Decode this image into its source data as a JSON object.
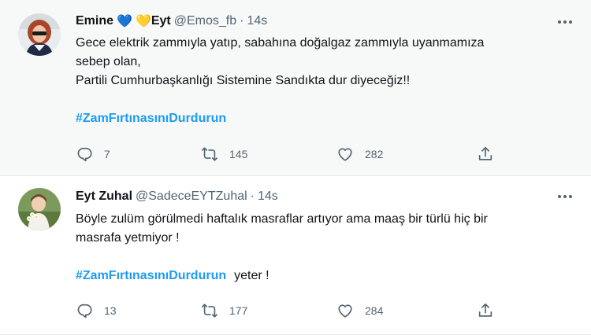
{
  "tweets": [
    {
      "name": "Emine",
      "hearts": [
        "💙",
        "💛"
      ],
      "name_suffix": "Eyt",
      "handle": "@Emos_fb",
      "separator": "·",
      "time": "14s",
      "lines": [
        "Gece elektrik zammıyla yatıp, sabahına doğalgaz zammıyla uyanmamıza",
        "sebep olan,",
        "Partili Cumhurbaşkanlığı Sistemine Sandıkta dur diyeceğiz!!"
      ],
      "hashtag": "#ZamFırtınasınıDurdurun",
      "after_hashtag": "",
      "replies": "7",
      "retweets": "145",
      "likes": "282"
    },
    {
      "name": "Eyt Zuhal",
      "handle": "@SadeceEYTZuhal",
      "separator": "·",
      "time": "14s",
      "lines": [
        "Böyle zulüm görülmedi haftalık masraflar artıyor ama maaş bir türlü hiç bir",
        "masrafa yetmiyor !"
      ],
      "hashtag": "#ZamFırtınasınıDurdurun",
      "after_hashtag": "yeter !",
      "replies": "13",
      "retweets": "177",
      "likes": "284"
    }
  ],
  "icons": {
    "reply": "reply-icon",
    "retweet": "retweet-icon",
    "like": "heart-icon",
    "share": "share-icon",
    "more": "more-dots-icon"
  },
  "colors": {
    "hashtag": "#1d9bf0",
    "secondary_text": "#536471",
    "primary_text": "#0f1419",
    "hover_background": "#f7f9f9"
  }
}
